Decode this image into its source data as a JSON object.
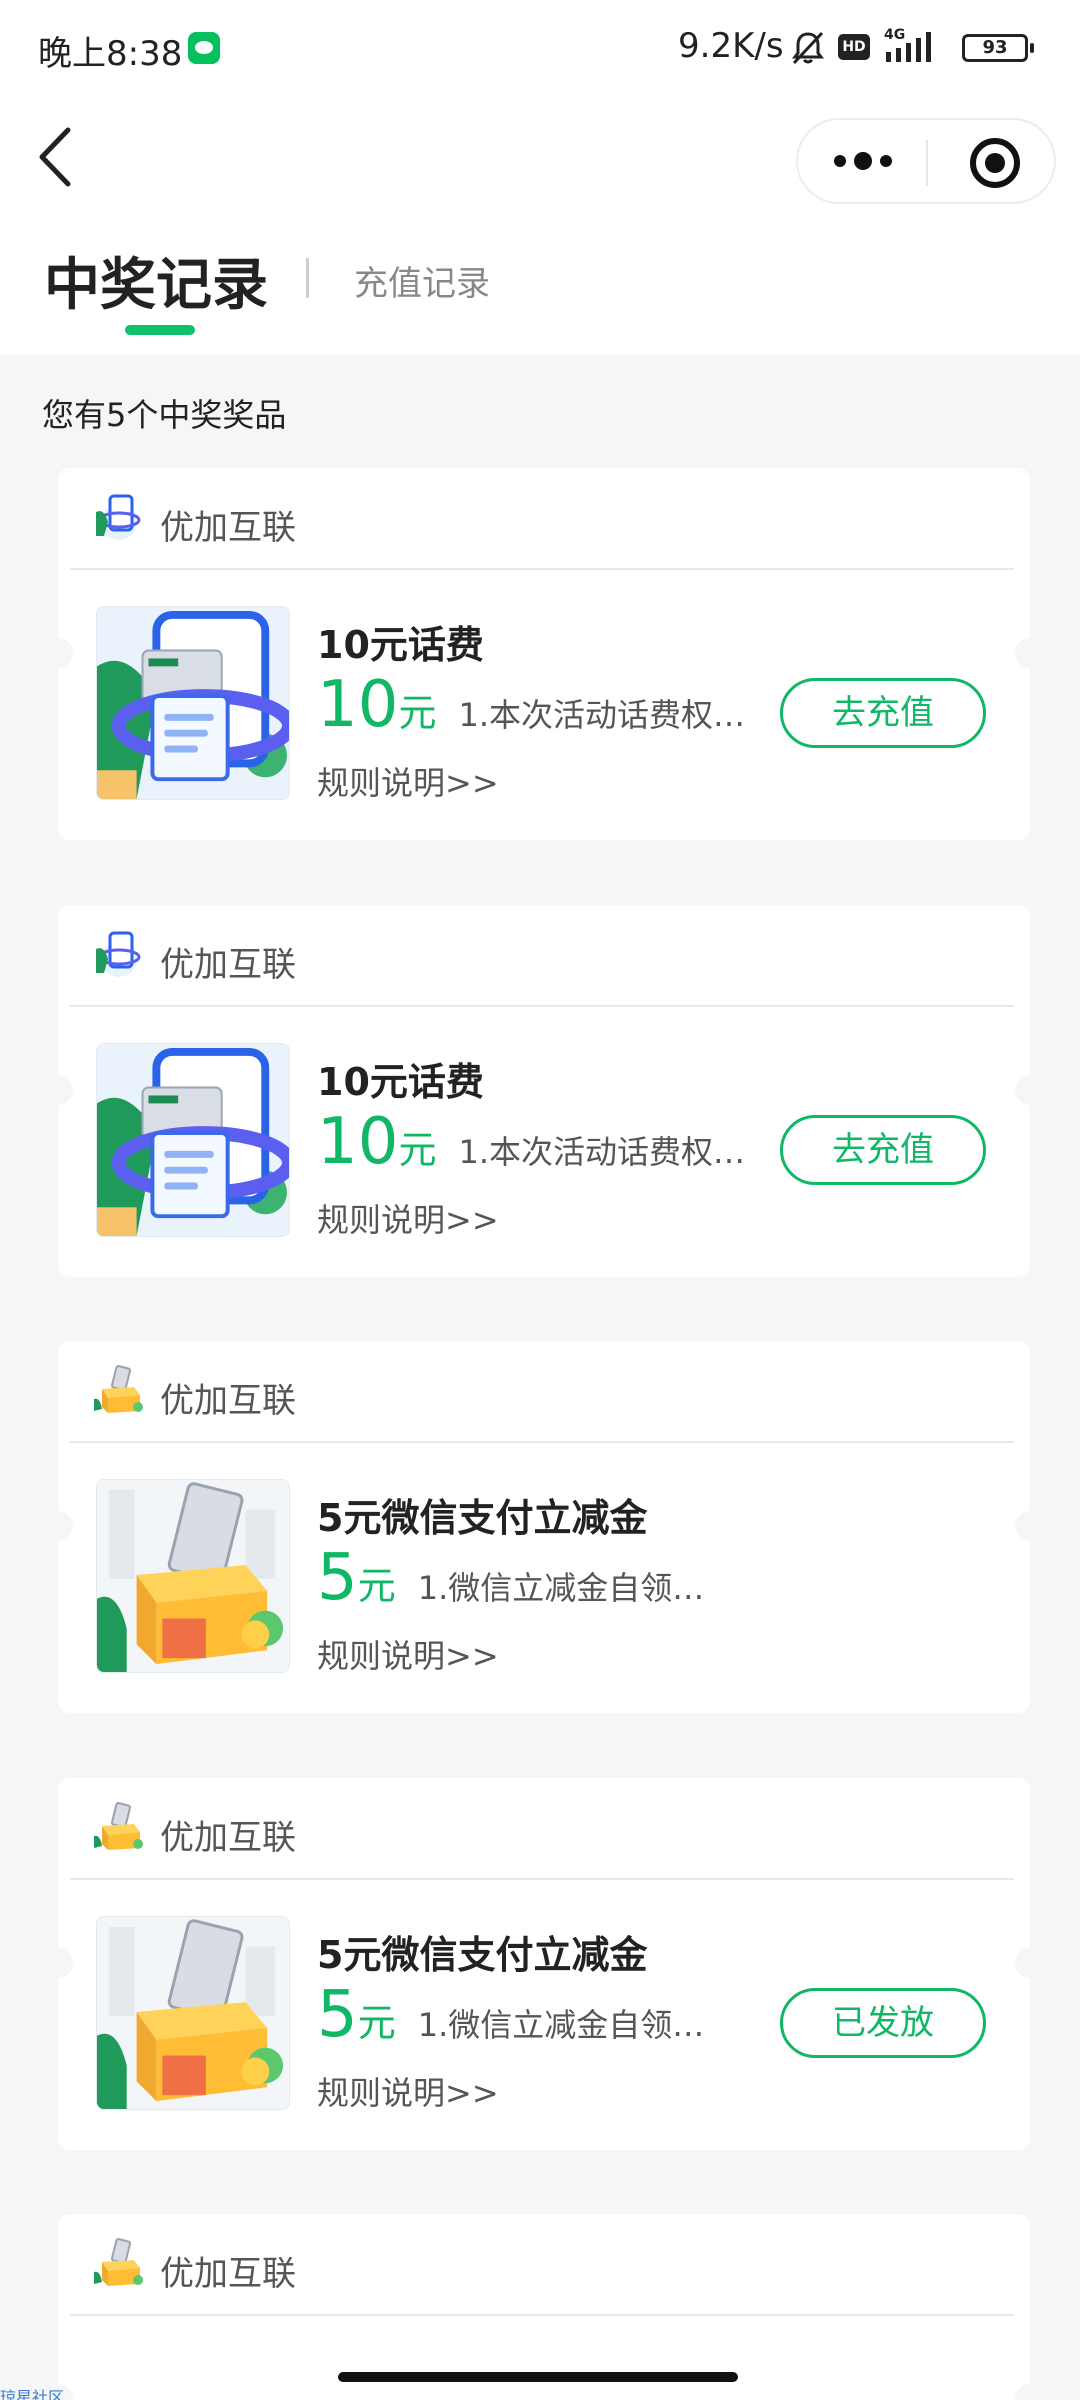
{
  "status_bar": {
    "time": "晚上8:38",
    "net_speed": "9.2K/s",
    "hd_badge": "HD",
    "network": "4G",
    "battery": "93"
  },
  "nav": {
    "back_icon": "chevron-left-icon",
    "more_icon": "more-dots-icon",
    "close_icon": "target-close-icon"
  },
  "tabs": {
    "active": "中奖记录",
    "inactive": "充值记录"
  },
  "summary": "您有5个中奖奖品",
  "accent_color": "#10b765",
  "cards": [
    {
      "vendor": "优加互联",
      "title": "10元话费",
      "amount": "10",
      "unit": "元",
      "description": "1.本次活动话费权…",
      "rules": "规则说明>>",
      "button": "去充值",
      "thumb_type": "phone"
    },
    {
      "vendor": "优加互联",
      "title": "10元话费",
      "amount": "10",
      "unit": "元",
      "description": "1.本次活动话费权…",
      "rules": "规则说明>>",
      "button": "去充值",
      "thumb_type": "phone"
    },
    {
      "vendor": "优加互联",
      "title": "5元微信支付立减金",
      "amount": "5",
      "unit": "元",
      "description": "1.微信立减金自领…",
      "rules": "规则说明>>",
      "button": "",
      "thumb_type": "box"
    },
    {
      "vendor": "优加互联",
      "title": "5元微信支付立减金",
      "amount": "5",
      "unit": "元",
      "description": "1.微信立减金自领…",
      "rules": "规则说明>>",
      "button": "已发放",
      "thumb_type": "box"
    },
    {
      "vendor": "优加互联",
      "thumb_type": "box"
    }
  ],
  "watermark": "琼星社区"
}
